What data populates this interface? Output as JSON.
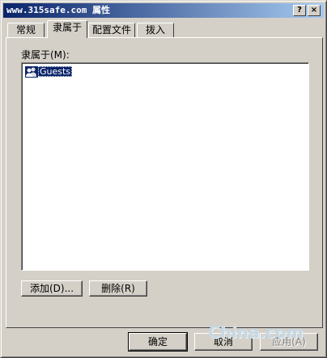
{
  "window": {
    "title": "www.315safe.com 属性",
    "help_button": "?",
    "close_button": "×"
  },
  "tabs": [
    {
      "label": "常规",
      "active": false
    },
    {
      "label": "隶属于",
      "active": true
    },
    {
      "label": "配置文件",
      "active": false
    },
    {
      "label": "拨入",
      "active": false
    }
  ],
  "member_of": {
    "label": "隶属于(M):",
    "items": [
      {
        "icon": "user-group-icon",
        "name": "Guests",
        "selected": true
      }
    ]
  },
  "actions": {
    "add_label": "添加(D)...",
    "remove_label": "删除(R)"
  },
  "footer": {
    "ok_label": "确定",
    "cancel_label": "取消",
    "apply_label": "应用(A)",
    "apply_disabled": true
  },
  "watermark": "China.com"
}
